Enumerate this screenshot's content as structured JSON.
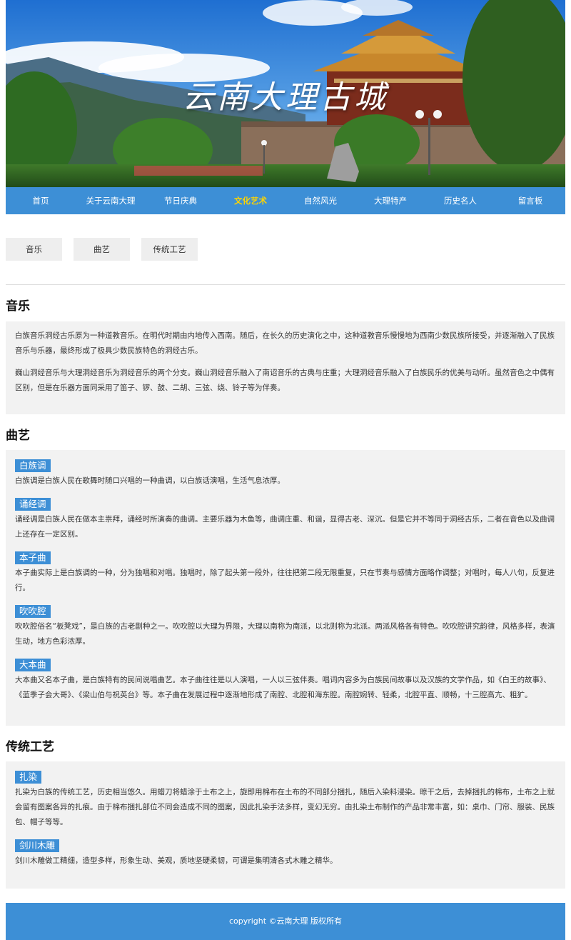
{
  "banner": {
    "title": "云南大理古城"
  },
  "nav": {
    "items": [
      {
        "label": "首页"
      },
      {
        "label": "关于云南大理"
      },
      {
        "label": "节日庆典"
      },
      {
        "label": "文化艺术"
      },
      {
        "label": "自然风光"
      },
      {
        "label": "大理特产"
      },
      {
        "label": "历史名人"
      },
      {
        "label": "留言板"
      }
    ],
    "active": "文化艺术"
  },
  "tabs": [
    {
      "label": "音乐"
    },
    {
      "label": "曲艺"
    },
    {
      "label": "传统工艺"
    }
  ],
  "music": {
    "title": "音乐",
    "paragraphs": [
      "白族音乐洞经古乐原为一种道教音乐。在明代时期由内地传入西南。随后，在长久的历史演化之中，这种道教音乐慢慢地为西南少数民族所接受，并逐渐融入了民族音乐与乐器，最终形成了极具少数民族特色的洞经古乐。",
      "巍山洞经音乐与大理洞经音乐为洞经音乐的两个分支。巍山洞经音乐融入了南诏音乐的古典与庄重；大理洞经音乐融入了白族民乐的优美与动听。虽然音色之中偶有区别，但是在乐器方面同采用了笛子、锣、鼓、二胡、三弦、绕、铃子等为伴奏。"
    ]
  },
  "quyi": {
    "title": "曲艺",
    "items": [
      {
        "tag": "白族调",
        "text": "白族调是白族人民在歌舞时随口兴唱的一种曲调，以白族话演唱，生活气息浓厚。"
      },
      {
        "tag": "诵经调",
        "text": "诵经调是白族人民在做本主祟拜，诵经时所演奏的曲调。主要乐器为木鱼等，曲调庄重、和谐，显得古老、深沉。但是它并不等同于洞经古乐，二者在音色以及曲调上还存在一定区别。"
      },
      {
        "tag": "本子曲",
        "text": "本子曲实际上是白族调的一种，分为独唱和对唱。独唱时，除了起头第一段外，往往把第二段无限重复，只在节奏与感情方面略作调整；对唱时，每人八句，反复进行。"
      },
      {
        "tag": "吹吹腔",
        "text": "吹吹腔俗名“板凳戏”，是白族的古老剧种之一。吹吹腔以大理为界限，大理以南称为南派，以北则称为北派。两派风格各有特色。吹吹腔讲究韵律，风格多样，表演生动，地方色彩浓厚。"
      },
      {
        "tag": "大本曲",
        "text": "大本曲又名本子曲，是白族特有的民间说唱曲艺。本子曲往往是以人演唱，一人以三弦伴奏。唱词内容多为白族民间故事以及汉族的文学作品，如《白王的故事》、《蓝季子会大哥》、《梁山伯与祝英台》等。本子曲在发展过程中逐渐地形成了南腔、北腔和海东腔。南腔婉转、轻柔，北腔平直、顺畅，十三腔高亢、粗犷。"
      }
    ]
  },
  "craft": {
    "title": "传统工艺",
    "items": [
      {
        "tag": "扎染",
        "text": "扎染为白族的传统工艺，历史相当悠久。用蜡刀将蜡涂于土布之上，旋即用棉布在土布的不同部分捆扎，随后入染料浸染。晾干之后，去掉捆扎的棉布，土布之上就会留有图案各异的扎痕。由于棉布捆扎部位不同会造成不同的图案，因此扎染手法多样，变幻无穷。由扎染土布制作的产品非常丰富，如：桌巾、门帘、服装、民族包、帽子等等。"
      },
      {
        "tag": "剑川木雕",
        "text": "剑川木雕做工精细，造型多样，形象生动、美观，质地坚硬柔韧，可谓是集明清各式木雕之精华。"
      }
    ]
  },
  "footer": {
    "text": "copyright ©云南大理 版权所有"
  },
  "colors": {
    "accent": "#3d8fd6",
    "active_nav": "#ffd400",
    "panel_bg": "#f2f2f2",
    "tab_bg": "#eeeeee"
  }
}
